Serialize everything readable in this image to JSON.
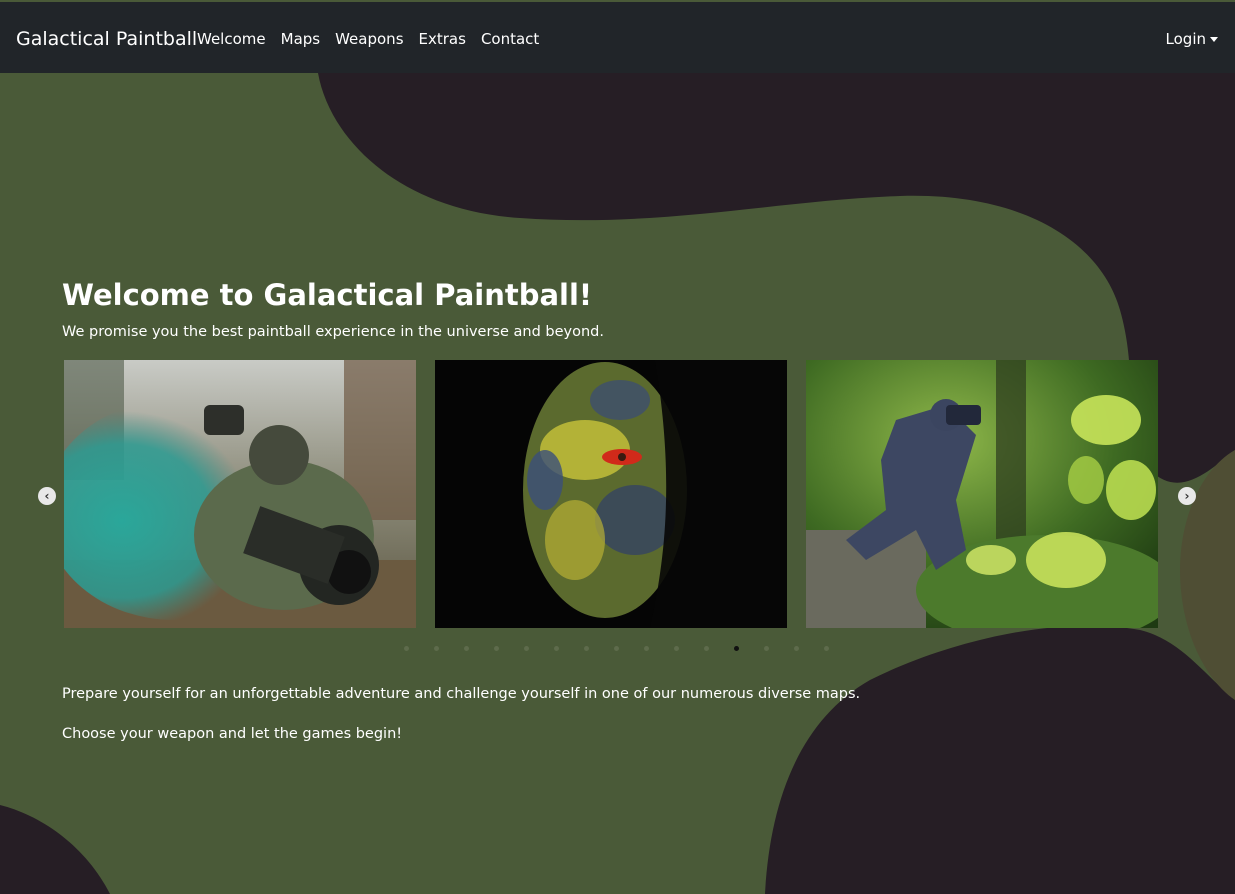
{
  "navbar": {
    "brand": "Galactical Paintball",
    "links": [
      "Welcome",
      "Maps",
      "Weapons",
      "Extras",
      "Contact"
    ],
    "login_label": "Login"
  },
  "hero": {
    "title": "Welcome to Galactical Paintball!",
    "subtitle": "We promise you the best paintball experience in the universe and beyond."
  },
  "carousel": {
    "prev_icon": "chevron-left-icon",
    "next_icon": "chevron-right-icon",
    "slides": [
      {
        "image": "soldier-with-teal-smoke-image"
      },
      {
        "image": "camouflage-painted-face-image"
      },
      {
        "image": "man-with-binoculars-image"
      }
    ],
    "indicator_count": 15,
    "active_indicator": 11
  },
  "body": {
    "paragraphs": [
      "Prepare yourself for an unforgettable adventure and challenge yourself in one of our numerous diverse maps.",
      "Choose your weapon and let the games begin!"
    ]
  },
  "colors": {
    "navbar_bg": "#212529",
    "olive_green": "#4a5a38",
    "dark_plum": "#261e25",
    "olive_khaki": "#4f4e34"
  }
}
